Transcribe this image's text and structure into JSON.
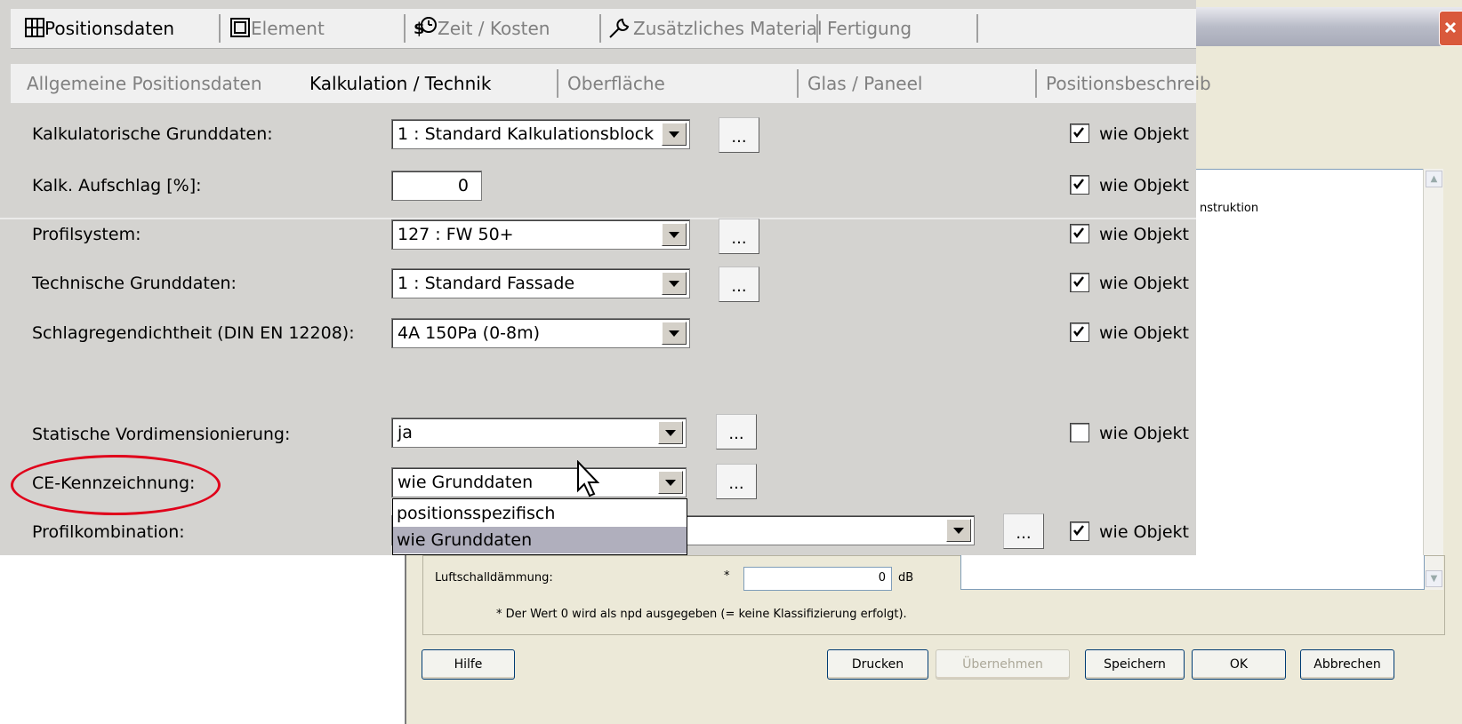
{
  "main_tabs": [
    {
      "label": "Positionsdaten",
      "icon": "grid-icon",
      "active": true
    },
    {
      "label": "Element",
      "icon": "element-icon",
      "active": false
    },
    {
      "label": "Zeit / Kosten",
      "icon": "clock-cost-icon",
      "active": false
    },
    {
      "label": "Zusätzliches Material",
      "icon": "wrench-icon",
      "active": false
    },
    {
      "label": "Fertigung",
      "active": false
    }
  ],
  "sub_tabs": [
    {
      "label": "Allgemeine Positionsdaten",
      "active": false
    },
    {
      "label": "Kalkulation / Technik",
      "active": true
    },
    {
      "label": "Oberfläche",
      "active": false
    },
    {
      "label": "Glas / Paneel",
      "active": false
    },
    {
      "label": "Positionsbeschreib",
      "active": false
    }
  ],
  "fields": {
    "kalk_grunddaten": {
      "label": "Kalkulatorische Grunddaten:",
      "value": "1 :  Standard Kalkulationsblock",
      "dots": "...",
      "wie_objekt": "wie Objekt",
      "checked": true
    },
    "kalk_aufschlag": {
      "label": "Kalk. Aufschlag [%]:",
      "value": "0",
      "wie_objekt": "wie Objekt",
      "checked": true
    },
    "profilsystem": {
      "label": "Profilsystem:",
      "value": "127 :  FW 50+",
      "dots": "...",
      "wie_objekt": "wie Objekt",
      "checked": true
    },
    "tech_grunddaten": {
      "label": "Technische Grunddaten:",
      "value": "1 :  Standard Fassade",
      "dots": "...",
      "wie_objekt": "wie Objekt",
      "checked": true
    },
    "schlagregen": {
      "label": "Schlagregendichtheit (DIN EN 12208):",
      "value": "4A 150Pa (0-8m)",
      "wie_objekt": "wie Objekt",
      "checked": true
    },
    "statische": {
      "label": "Statische Vordimensionierung:",
      "value": "ja",
      "dots": "...",
      "wie_objekt": "wie Objekt",
      "checked": false
    },
    "ce": {
      "label": "CE-Kennzeichnung:",
      "value": "wie Grunddaten",
      "dots": "..."
    },
    "profilkombination": {
      "label": "Profilkombination:",
      "value": "",
      "dots": "...",
      "wie_objekt": "wie Objekt",
      "checked": true
    }
  },
  "ce_dropdown_options": [
    {
      "label": "positionsspezifisch",
      "selected": false
    },
    {
      "label": "wie Grunddaten",
      "selected": true
    }
  ],
  "background_dialog": {
    "list_text": "nstruktion",
    "luftschall_label": "Luftschalldämmung:",
    "luftschall_star": "*",
    "luftschall_value": "0",
    "luftschall_unit": "dB",
    "note": "* Der Wert 0 wird als npd ausgegeben  (= keine Klassifizierung erfolgt).",
    "buttons": {
      "hilfe": "Hilfe",
      "drucken": "Drucken",
      "uebernehmen": "Übernehmen",
      "speichern": "Speichern",
      "ok": "OK",
      "abbrechen": "Abbrechen"
    }
  },
  "colors": {
    "highlight_ellipse": "#e0001a",
    "panel_bg": "#d4d3d0",
    "dialog_bg": "#ece9d8"
  }
}
